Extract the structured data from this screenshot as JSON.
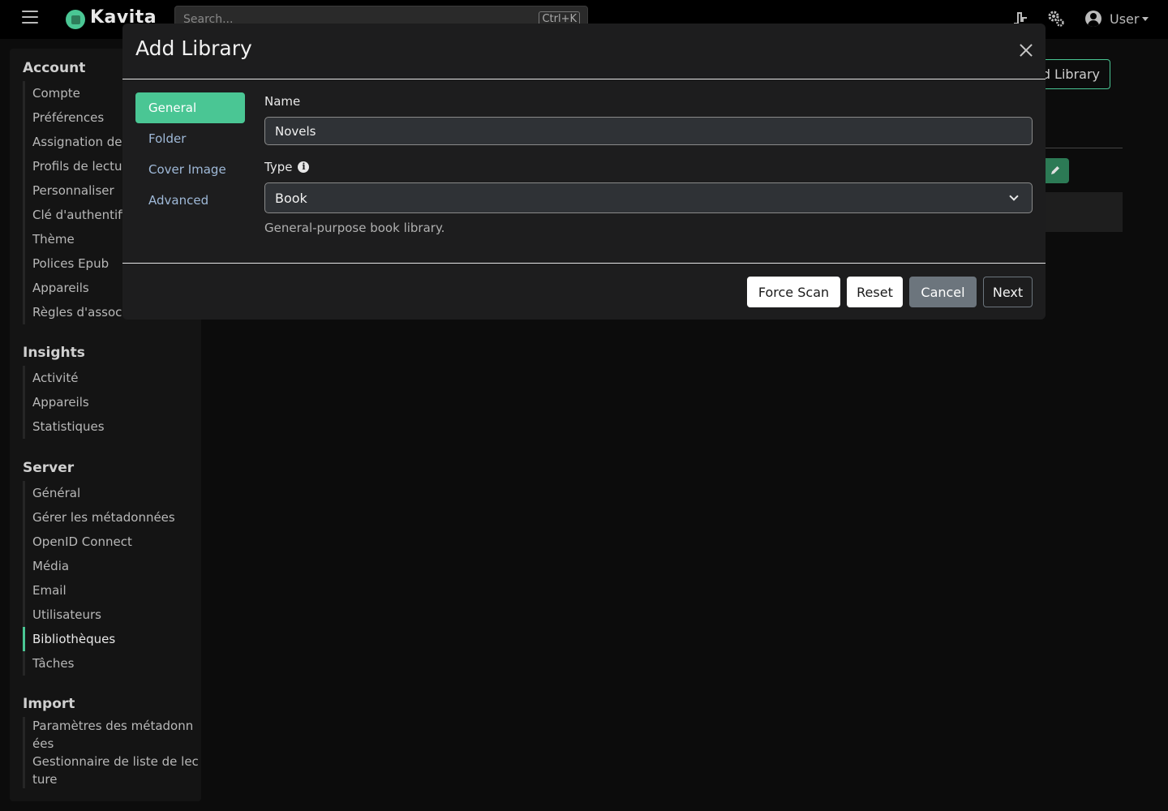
{
  "navbar": {
    "brand": "Kavita",
    "search_placeholder": "Search...",
    "search_shortcut": "Ctrl+K",
    "user_label": "User",
    "icons": [
      "hamburger-icon",
      "kavita-logo",
      "activity-icon",
      "settings-gears-icon",
      "user-circle-icon"
    ]
  },
  "sidebar": {
    "sections": [
      {
        "heading": "Account",
        "items": [
          "Compte",
          "Préférences",
          "Assignation des",
          "Profils de lecture",
          "Personnaliser",
          "Clé d'authentifi",
          "Thème",
          "Polices Epub",
          "Appareils",
          "Règles d'associ"
        ]
      },
      {
        "heading": "Insights",
        "items": [
          "Activité",
          "Appareils",
          "Statistiques"
        ]
      },
      {
        "heading": "Server",
        "items": [
          "Général",
          "Gérer les métadonnées",
          "OpenID Connect",
          "Média",
          "Email",
          "Utilisateurs",
          "Bibliothèques",
          "Tâches"
        ],
        "active": "Bibliothèques"
      },
      {
        "heading": "Import",
        "items": [
          "Paramètres des métadonnées",
          "Gestionnaire de liste de lecture"
        ]
      }
    ]
  },
  "background": {
    "add_library_label": "d Library"
  },
  "modal": {
    "title": "Add Library",
    "tabs": [
      "General",
      "Folder",
      "Cover Image",
      "Advanced"
    ],
    "active_tab": "General",
    "name_label": "Name",
    "name_value": "Novels",
    "type_label": "Type",
    "type_value": "Book",
    "type_help": "General-purpose book library.",
    "buttons": {
      "force_scan": "Force Scan",
      "reset": "Reset",
      "cancel": "Cancel",
      "next": "Next"
    }
  },
  "colors": {
    "accent": "#4ac694",
    "modal_bg": "#1d1d1e",
    "page_bg": "#0c0c0c",
    "cancel_bg": "#6c757d"
  }
}
